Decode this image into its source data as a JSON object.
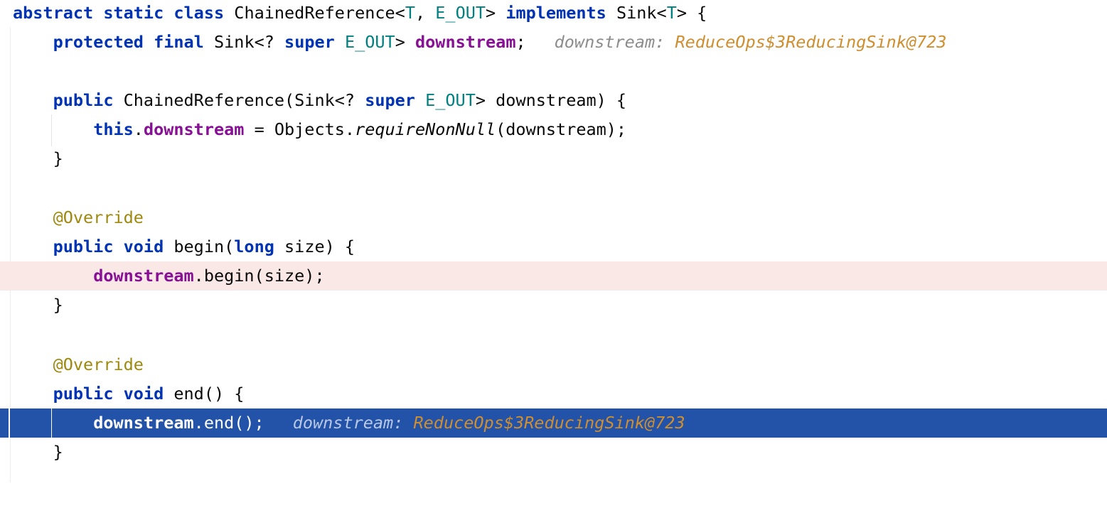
{
  "lines": {
    "l1": {
      "t1": "abstract",
      "t2": "static",
      "t3": "class",
      "t4": "ChainedReference<",
      "t5": "T",
      "t6": ", ",
      "t7": "E_OUT",
      "t8": "> ",
      "t9": "implements",
      "t10": "Sink<",
      "t11": "T",
      "t12": "> {"
    },
    "l2": {
      "t1": "protected",
      "t2": "final",
      "t3": "Sink<? ",
      "t4": "super",
      "t5": "E_OUT",
      "t6": "> ",
      "t7": "downstream",
      "t8": ";",
      "hint_label": "downstream:",
      "hint_value": "ReduceOps$3ReducingSink@723"
    },
    "l3": {
      "t1": "public",
      "t2": "ChainedReference(Sink<? ",
      "t3": "super",
      "t4": "E_OUT",
      "t5": "> downstream) {"
    },
    "l4": {
      "t1": "this",
      "t2": ".",
      "t3": "downstream",
      "t4": " = Objects.",
      "t5": "requireNonNull",
      "t6": "(downstream);"
    },
    "l5": {
      "t1": "}"
    },
    "l6": {
      "t1": "@Override"
    },
    "l7": {
      "t1": "public",
      "t2": "void",
      "t3": "begin(",
      "t4": "long",
      "t5": " size) {"
    },
    "l8": {
      "t1": "downstream",
      "t2": ".begin(size);"
    },
    "l9": {
      "t1": "}"
    },
    "l10": {
      "t1": "@Override"
    },
    "l11": {
      "t1": "public",
      "t2": "void",
      "t3": "end() {"
    },
    "l12": {
      "t1": "downstream",
      "t2": ".end();",
      "hint_label": "downstream:",
      "hint_value": "ReduceOps$3ReducingSink@723"
    },
    "l13": {
      "t1": "}"
    }
  },
  "colors": {
    "keyword": "#0033b3",
    "type_param": "#008080",
    "field": "#871094",
    "annotation": "#9e880d",
    "hint_value": "#cf8e2f",
    "breakpoint_line": "#fae8e6",
    "execution_line": "#2253a9"
  }
}
